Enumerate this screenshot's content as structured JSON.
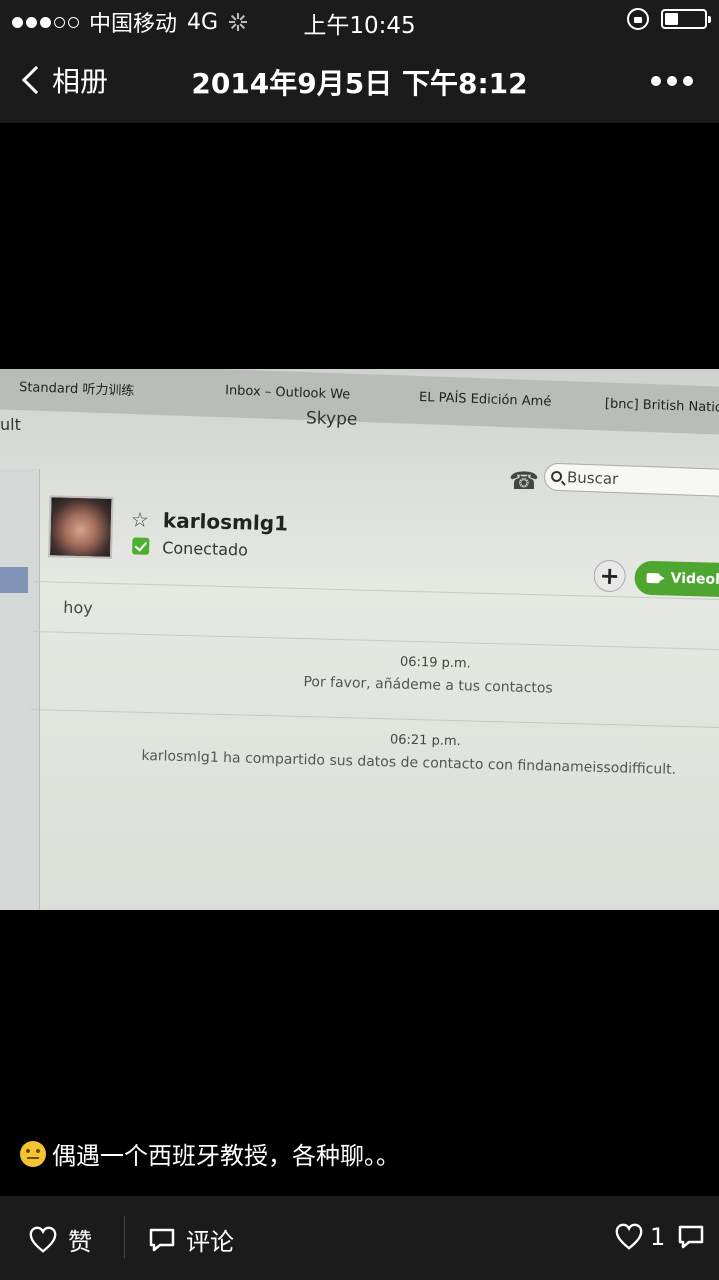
{
  "status_bar": {
    "carrier": "中国移动",
    "network": "4G",
    "time": "上午10:45",
    "signal_bars_filled": 3,
    "signal_bars_total": 5,
    "battery_level": 0.35
  },
  "nav": {
    "back_label": "相册",
    "title": "2014年9月5日 下午8:12",
    "more_icon": "ellipsis-icon"
  },
  "photo": {
    "browser_tabs": [
      "Standard 听力训练",
      "Inbox – Outlook We",
      "EL PAÍS Edición Amé",
      "[bnc] British Nation"
    ],
    "window_title": "Skype",
    "left_partial_text": "ult",
    "search_placeholder": "Buscar",
    "contact": {
      "name": "karlosmlg1",
      "status": "Conectado"
    },
    "add_button": "+",
    "video_button": "Videolla",
    "day_label": "hoy",
    "messages": [
      {
        "time": "06:19 p.m.",
        "text": "Por favor, añádeme a tus contactos"
      },
      {
        "time": "06:21 p.m.",
        "text": "karlosmlg1 ha compartido sus datos de contacto con findanameissodifficult."
      }
    ]
  },
  "caption": {
    "text": "偶遇一个西班牙教授，各种聊。。"
  },
  "bottom_bar": {
    "like_label": "赞",
    "comment_label": "评论",
    "like_count": "1"
  },
  "colors": {
    "bar_bg": "#1b1b1b",
    "skype_green": "#4ea530"
  }
}
